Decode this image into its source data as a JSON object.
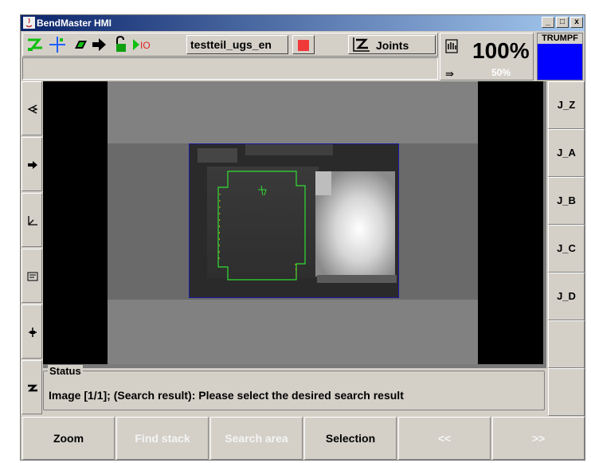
{
  "window": {
    "title": "BendMaster HMI",
    "controls": {
      "minimize": "_",
      "maximize": "□",
      "close": "x"
    }
  },
  "toolbar": {
    "program_name": "testteil_ugs_en",
    "joints_label": "Joints",
    "icons": [
      "gripper-icon",
      "crosshair-icon",
      "stack-icon",
      "arrow-right-icon",
      "lock-icon",
      "io-icon"
    ],
    "io_label": "IO"
  },
  "speed": {
    "main": "100%",
    "secondary": "50%"
  },
  "brand": {
    "logo": "TRUMPF",
    "color": "#0000ff"
  },
  "left_icons": [
    "eye-icon",
    "arrow-right-icon",
    "axis-icon",
    "list-icon",
    "align-icon",
    "gripper-z-icon"
  ],
  "joints": [
    "J_Z",
    "J_A",
    "J_B",
    "J_C",
    "J_D"
  ],
  "status": {
    "legend": "Status",
    "message": "Image [1/1]; (Search result): Please select the desired search result"
  },
  "bottom": {
    "zoom": "Zoom",
    "find_stack": "Find stack",
    "search_area": "Search area",
    "selection": "Selection",
    "prev": "<<",
    "next": ">>"
  },
  "colors": {
    "accent": "#0a246a",
    "stop": "#f03a3a",
    "contour": "#33dd33"
  }
}
